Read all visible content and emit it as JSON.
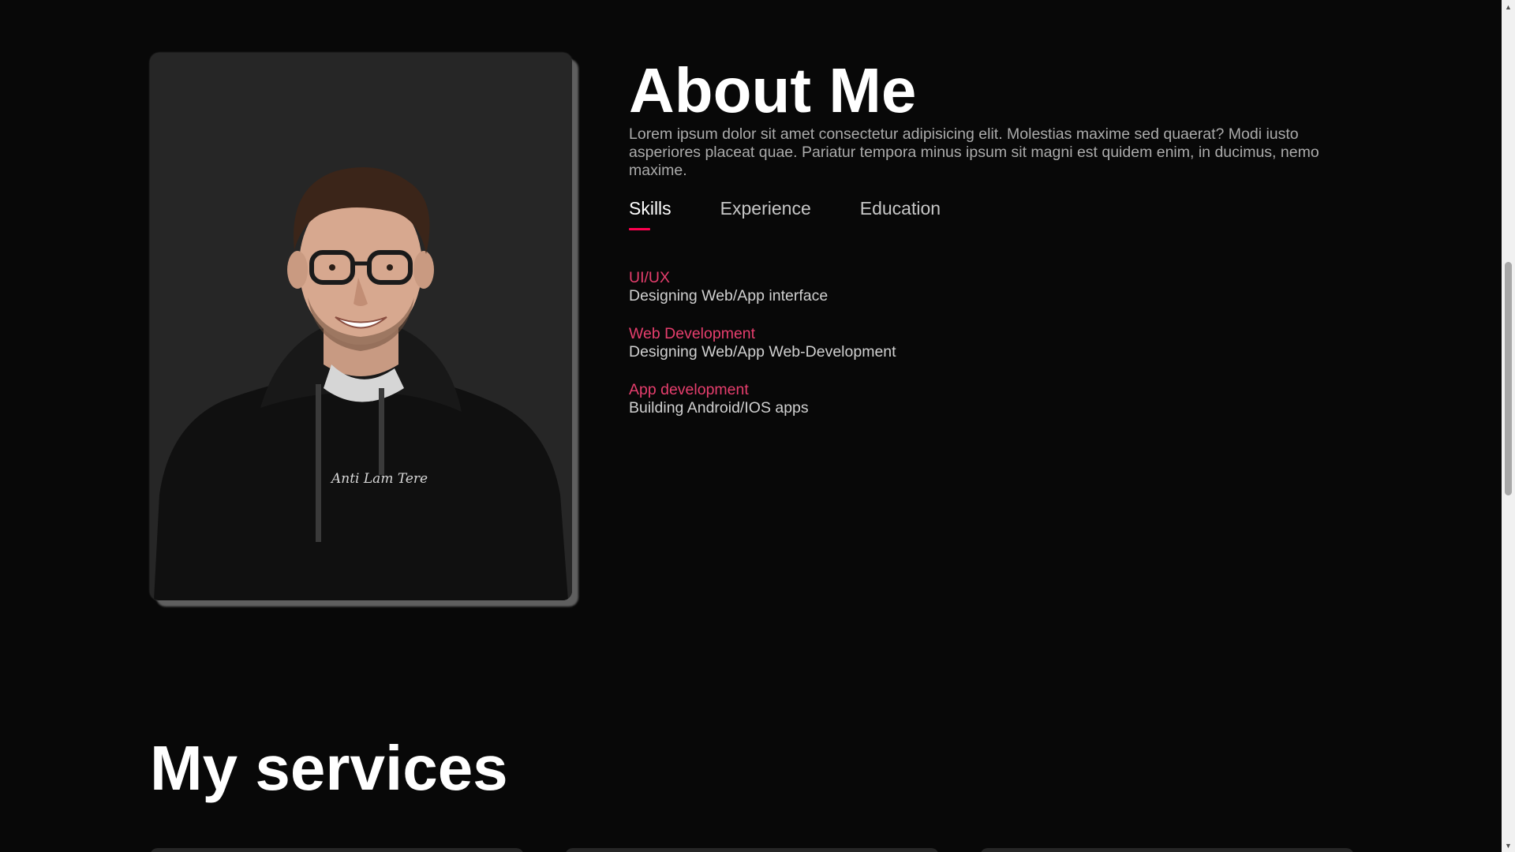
{
  "about": {
    "title": "About Me",
    "description": "Lorem ipsum dolor sit amet consectetur adipisicing elit. Molestias maxime sed quaerat? Modi iusto asperiores placeat quae. Pariatur tempora minus ipsum sit magni est quidem enim, in ducimus, nemo maxime.",
    "tabs": [
      {
        "label": "Skills",
        "active": true
      },
      {
        "label": "Experience",
        "active": false
      },
      {
        "label": "Education",
        "active": false
      }
    ],
    "skills": [
      {
        "name": "UI/UX",
        "desc": "Designing Web/App interface"
      },
      {
        "name": "Web Development",
        "desc": "Designing Web/App Web-Development"
      },
      {
        "name": "App development",
        "desc": "Building Android/IOS apps"
      }
    ]
  },
  "services": {
    "title": "My services"
  },
  "colors": {
    "background": "#080808",
    "accent": "#ff004f",
    "skill_name": "#e63e6d",
    "heading": "#ffffff",
    "text": "#ababab"
  },
  "icons": {
    "scroll_up": "scroll-up-arrow-icon",
    "scroll_down": "scroll-down-arrow-icon"
  }
}
